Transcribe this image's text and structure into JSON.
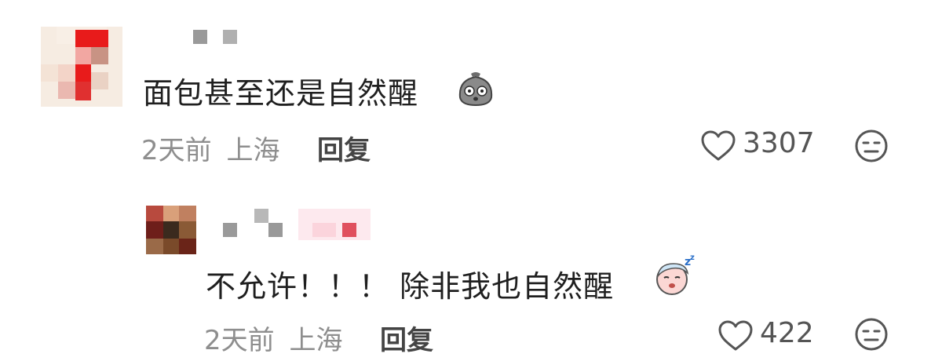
{
  "comments": [
    {
      "text": "面包甚至还是自然醒",
      "emoji_icon": "sleepy-bun-emoji-icon",
      "time": "2天前",
      "location": "上海",
      "reply_label": "回复",
      "likes": "3307"
    },
    {
      "text": "不允许！！！ 除非我也自然醒",
      "emoji_icon": "sleeping-face-emoji-icon",
      "time": "2天前",
      "location": "上海",
      "reply_label": "回复",
      "likes": "422"
    }
  ]
}
